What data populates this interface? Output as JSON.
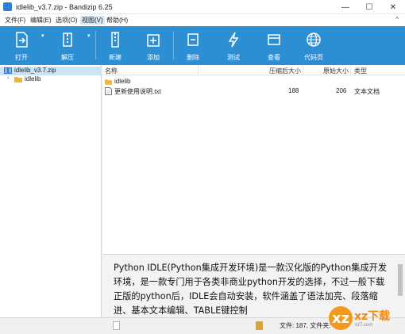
{
  "window": {
    "title": "idlelib_v3.7.zip - Bandizip 6.25",
    "minimize_glyph": "—",
    "maximize_glyph": "☐",
    "close_glyph": "✕"
  },
  "menu": {
    "items": [
      "文件(F)",
      "编辑(E)",
      "选项(O)",
      "视图(V)",
      "帮助(H)"
    ],
    "caret": "^"
  },
  "toolbar": {
    "buttons": [
      "打开",
      "解压",
      "新建",
      "添加",
      "删除",
      "测试",
      "查看",
      "代码页"
    ],
    "arrow_glyph": "▾"
  },
  "tree": {
    "root": "idlelib_v3.7.zip",
    "child": "idlelib",
    "collapsed_glyph": "›"
  },
  "list": {
    "columns": {
      "name": "名称",
      "packed": "压缩后大小",
      "original": "原始大小",
      "type": "类型"
    },
    "rows": [
      {
        "name": "idlelib",
        "packed": "",
        "original": "",
        "type": ""
      },
      {
        "name": "更新使用说明.txt",
        "packed": "188",
        "original": "206",
        "type": "文本文档"
      }
    ]
  },
  "description": {
    "text": "Python IDLE(Python集成开发环境)是一款汉化版的Python集成开发环境，是一款专门用于各类非商业python开发的选择，不过一般下载正版的python后，IDLE会自动安装，软件涵盖了语法加亮、段落缩进、基本文本编辑、TABLE键控制"
  },
  "status": {
    "text": "文件: 187, 文件夹: 6"
  },
  "watermark": {
    "mark": "xz",
    "name": "xz下载",
    "subtitle": "xz7.com"
  },
  "colors": {
    "toolbar": "#2c8fd4",
    "selection": "#cce4f7",
    "folder": "#e8b83f"
  }
}
